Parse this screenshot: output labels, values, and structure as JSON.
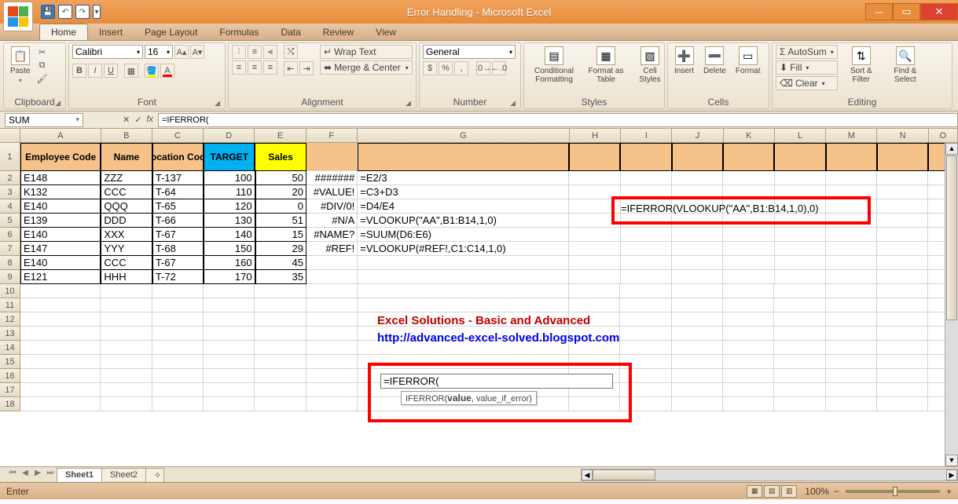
{
  "title": "Error Handling - Microsoft Excel",
  "tabs": {
    "home": "Home",
    "insert": "Insert",
    "pageLayout": "Page Layout",
    "formulas": "Formulas",
    "data": "Data",
    "review": "Review",
    "view": "View"
  },
  "groups": {
    "clipboard": "Clipboard",
    "font": "Font",
    "alignment": "Alignment",
    "number": "Number",
    "styles": "Styles",
    "cells": "Cells",
    "editing": "Editing"
  },
  "buttons": {
    "paste": "Paste",
    "wrapText": "Wrap Text",
    "merge": "Merge & Center",
    "general": "General",
    "condFmt": "Conditional Formatting",
    "fmtTable": "Format as Table",
    "cellStyles": "Cell Styles",
    "insert": "Insert",
    "delete": "Delete",
    "format": "Format",
    "autosum": "AutoSum",
    "fill": "Fill",
    "clear": "Clear",
    "sort": "Sort & Filter",
    "find": "Find & Select",
    "fontName": "Calibri",
    "fontSize": "16"
  },
  "namebox": "SUM",
  "formula": "=IFERROR(",
  "columns": [
    "A",
    "B",
    "C",
    "D",
    "E",
    "F",
    "G",
    "H",
    "I",
    "J",
    "K",
    "L",
    "M",
    "N",
    "O"
  ],
  "headers": {
    "a": "Employee Code",
    "b": "Name",
    "c": "Location Code",
    "d": "TARGET",
    "e": "Sales"
  },
  "rows": [
    {
      "a": "E148",
      "b": "ZZZ",
      "c": "T-137",
      "d": "100",
      "e": "50",
      "f": "#######",
      "g": "=E2/3"
    },
    {
      "a": "K132",
      "b": "CCC",
      "c": "T-64",
      "d": "110",
      "e": "20",
      "f": "#VALUE!",
      "g": "=C3+D3"
    },
    {
      "a": "E140",
      "b": "QQQ",
      "c": "T-65",
      "d": "120",
      "e": "0",
      "f": "#DIV/0!",
      "g": "=D4/E4"
    },
    {
      "a": "E139",
      "b": "DDD",
      "c": "T-66",
      "d": "130",
      "e": "51",
      "f": "#N/A",
      "g": "=VLOOKUP(\"AA\",B1:B14,1,0)"
    },
    {
      "a": "E140",
      "b": "XXX",
      "c": "T-67",
      "d": "140",
      "e": "15",
      "f": "#NAME?",
      "g": "=SUUM(D6:E6)"
    },
    {
      "a": "E147",
      "b": "YYY",
      "c": "T-68",
      "d": "150",
      "e": "29",
      "f": "#REF!",
      "g": "=VLOOKUP(#REF!,C1:C14,1,0)"
    },
    {
      "a": "E140",
      "b": "CCC",
      "c": "T-67",
      "d": "160",
      "e": "45",
      "f": "",
      "g": ""
    },
    {
      "a": "E121",
      "b": "HHH",
      "c": "T-72",
      "d": "170",
      "e": "35",
      "f": "",
      "g": ""
    }
  ],
  "calloutFormula": "=IFERROR(VLOOKUP(\"AA\",B1:B14,1,0),0)",
  "banner1": "Excel Solutions - Basic and Advanced",
  "banner2": "http://advanced-excel-solved.blogspot.com",
  "editCell": "=IFERROR(",
  "tooltip": "IFERROR(value, value_if_error)",
  "sheets": {
    "s1": "Sheet1",
    "s2": "Sheet2"
  },
  "status": "Enter",
  "zoom": "100%"
}
